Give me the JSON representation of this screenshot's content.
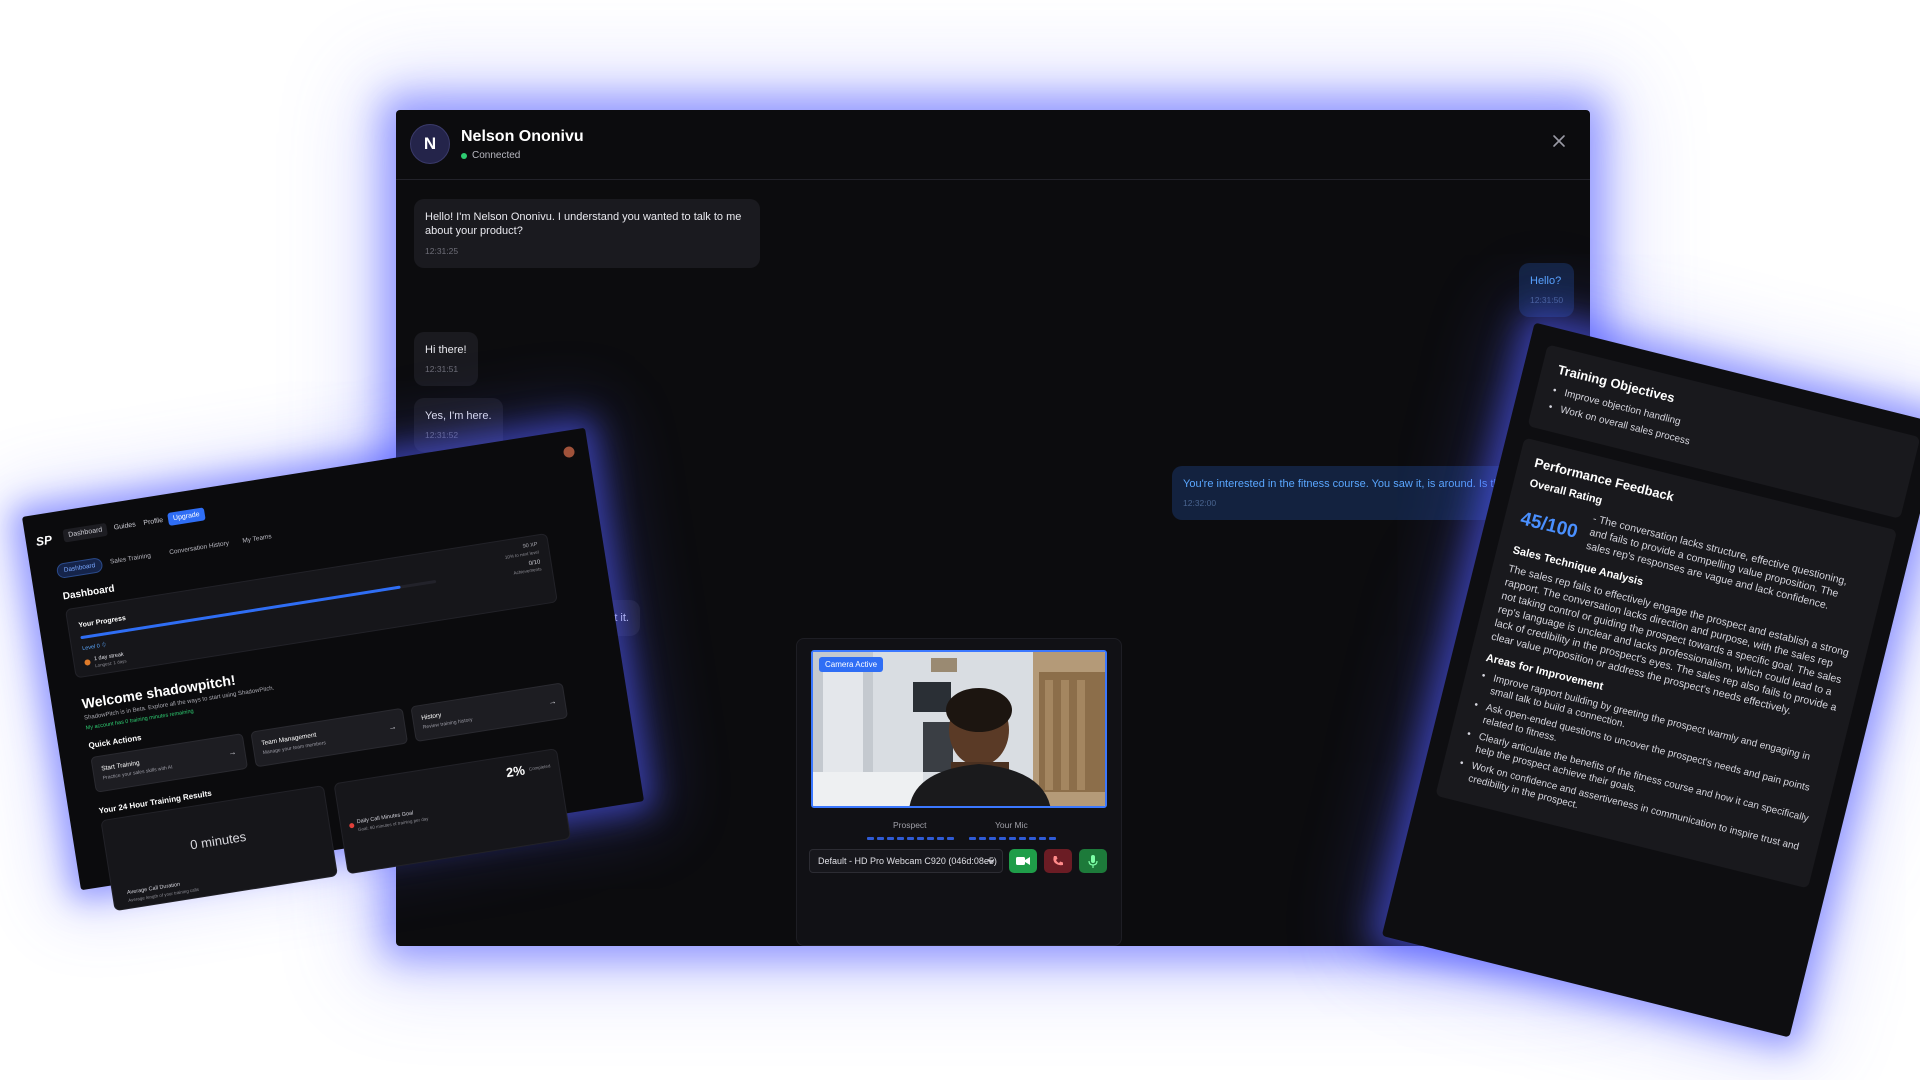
{
  "chat": {
    "contact_initial": "N",
    "contact_name": "Nelson Ononivu",
    "status": "Connected",
    "messages": [
      {
        "text": "Hello! I'm Nelson Ononivu. I understand you wanted to talk to me about your product?",
        "time": "12:31:25",
        "side": "in"
      },
      {
        "text": "Hello?",
        "time": "12:31:50",
        "side": "out"
      },
      {
        "text": "Hi there!",
        "time": "12:31:51",
        "side": "in"
      },
      {
        "text": "Yes, I'm here.",
        "time": "12:31:52",
        "side": "in"
      },
      {
        "text": "You're interested in the fitness course. You saw it, is around. Is th",
        "time": "12:32:00",
        "side": "out"
      },
      {
        "text": "bout it.",
        "time": "",
        "side": "in"
      }
    ],
    "video": {
      "badge": "Camera Active",
      "prospect_label": "Prospect",
      "mic_label": "Your Mic",
      "device": "Default - HD Pro Webcam C920 (046d:08e5)"
    },
    "colors": {
      "accent": "#2f6ef5",
      "camera_btn": "#1f9d49",
      "end_call_btn": "#6b1c24",
      "mic_btn": "#1d7a3a"
    }
  },
  "dashboard": {
    "logo": "SP",
    "nav": [
      "Dashboard",
      "Guides",
      "Profile",
      "Upgrade"
    ],
    "tabs": [
      "Dashboard",
      "Sales Training",
      "Conversation History",
      "My Teams"
    ],
    "title": "Dashboard",
    "progress": {
      "label": "Your Progress",
      "level": "Level 0 ⏀",
      "xp": "90 XP",
      "next_level": "10% to next level",
      "achievements_count": "0/10",
      "achievements_label": "Achievements",
      "streak": "1 day streak",
      "streak_sub": "Longest: 1 days",
      "fill": 0.9
    },
    "welcome": "Welcome shadowpitch!",
    "welcome_sub": "ShadowPitch is in Beta. Explore all the ways to start using ShadowPitch.",
    "minutes_note": "My account has 0 training minutes remaining",
    "quick_actions_title": "Quick Actions",
    "quick_actions": [
      {
        "title": "Start Training",
        "sub": "Practice your sales skills with AI"
      },
      {
        "title": "Team Management",
        "sub": "Manage your team members"
      },
      {
        "title": "History",
        "sub": "Review training history"
      }
    ],
    "results_title": "Your 24 Hour Training Results",
    "minutes_value": "0 minutes",
    "avg_title": "Average Call Duration",
    "avg_sub": "Average length of your training calls",
    "goal_percent": "2%",
    "goal_completed": "Completed",
    "goal_title": "Daily Call Minutes Goal",
    "goal_sub": "Goal: 60 minutes of training per day"
  },
  "feedback": {
    "objectives_title": "Training Objectives",
    "objectives": [
      "Improve objection handling",
      "Work on overall sales process"
    ],
    "performance_title": "Performance Feedback",
    "overall_rating_label": "Overall Rating",
    "rating": "45/100",
    "rating_text": "- The conversation lacks structure, effective questioning, and fails to provide a compelling value proposition. The sales rep's responses are vague and lack confidence.",
    "technique_title": "Sales Technique Analysis",
    "technique_text": "The sales rep fails to effectively engage the prospect and establish a strong rapport. The conversation lacks direction and purpose, with the sales rep not taking control or guiding the prospect towards a specific goal. The sales rep's language is unclear and lacks professionalism, which could lead to a lack of credibility in the prospect's eyes. The sales rep also fails to provide a clear value proposition or address the prospect's needs effectively.",
    "improvement_title": "Areas for Improvement",
    "improvements": [
      "Improve rapport building by greeting the prospect warmly and engaging in small talk to build a connection.",
      "Ask open-ended questions to uncover the prospect's needs and pain points related to fitness.",
      "Clearly articulate the benefits of the fitness course and how it can specifically help the prospect achieve their goals.",
      "Work on confidence and assertiveness in communication to inspire trust and credibility in the prospect."
    ]
  }
}
